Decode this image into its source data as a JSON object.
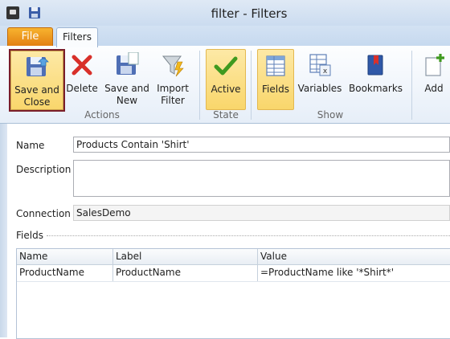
{
  "window": {
    "title": "filter - Filters"
  },
  "tabs": {
    "file": "File",
    "filters": "Filters"
  },
  "ribbon": {
    "actions": {
      "save_close": [
        "Save and",
        "Close"
      ],
      "delete": "Delete",
      "save_new": [
        "Save and",
        "New"
      ],
      "import_filter": [
        "Import",
        "Filter"
      ],
      "label": "Actions"
    },
    "state": {
      "active": "Active",
      "label": "State"
    },
    "show": {
      "fields": "Fields",
      "variables": "Variables",
      "bookmarks": "Bookmarks",
      "label": "Show"
    },
    "add": {
      "label": "Add"
    }
  },
  "form": {
    "name_label": "Name",
    "name_value": "Products Contain 'Shirt'",
    "description_label": "Description",
    "description_value": "",
    "connection_label": "Connection",
    "connection_value": "SalesDemo",
    "fields_label": "Fields"
  },
  "grid": {
    "columns": [
      "Name",
      "Label",
      "Value"
    ],
    "rows": [
      {
        "name": "ProductName",
        "label": "ProductName",
        "value": "=ProductName like '*Shirt*'"
      }
    ]
  },
  "colors": {
    "file_tab": "#e88a16",
    "highlight": "#f9d66b",
    "selected_border": "#7a1e2a",
    "accent": "#2b6cb0"
  }
}
